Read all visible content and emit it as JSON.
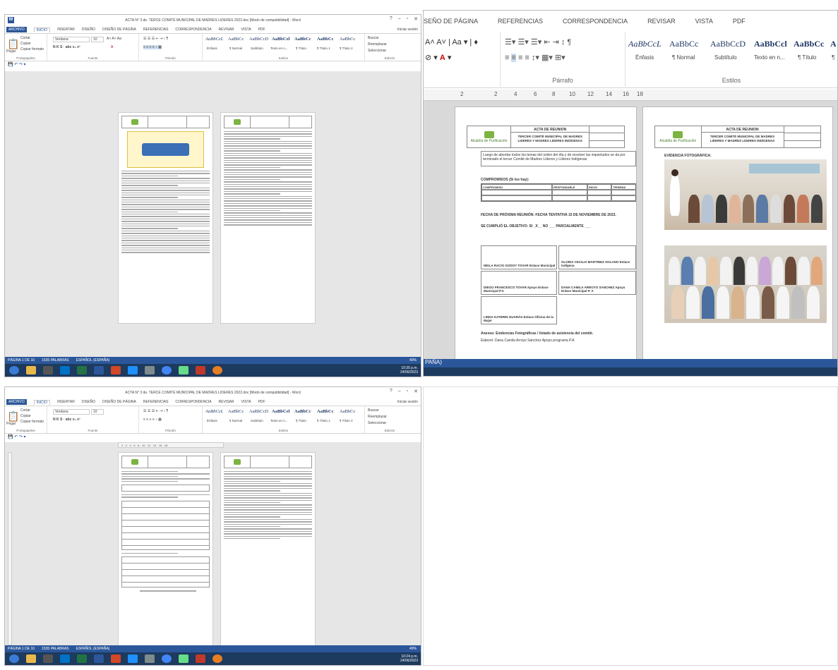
{
  "top_left": {
    "window_title": "ACTA N° 3 de. TERCE COMITÉ MUNICIPAL DE MADRES LIDERES 2022.doc [Modo de compatibilidad] - Word",
    "menu": [
      "ARCHIVO",
      "INICIO",
      "INSERTAR",
      "DISEÑO",
      "DISEÑO DE PÁGINA",
      "REFERENCIAS",
      "CORRESPONDENCIA",
      "REVISAR",
      "VISTA",
      "PDF"
    ],
    "login": "Iniciar sesión",
    "clipboard": {
      "paste": "Pegar",
      "cut": "Cortar",
      "copy": "Copiar",
      "format": "Copiar formato",
      "label": "Portapapeles"
    },
    "font": {
      "name": "Verdana",
      "size": "10",
      "label": "Fuente"
    },
    "paragraph_label": "Párrafo",
    "styles": [
      {
        "preview": "AaBbCcL",
        "name": "Énfasis"
      },
      {
        "preview": "AaBbCc",
        "name": "¶ Normal"
      },
      {
        "preview": "AaBbCcD",
        "name": "Subtítulo"
      },
      {
        "preview": "AaBbCel",
        "name": "Texto en n..."
      },
      {
        "preview": "AaBbCc",
        "name": "¶ Título"
      },
      {
        "preview": "AaBbCc",
        "name": "¶ Título 1"
      },
      {
        "preview": "AaBbCc",
        "name": "¶ Título 2"
      }
    ],
    "styles_label": "Estilos",
    "edit": {
      "find": "Buscar",
      "replace": "Reemplazar",
      "select": "Seleccionar",
      "label": "Edición"
    },
    "status": {
      "page": "PÁGINA 1 DE 10",
      "words": "1535 PALABRAS",
      "lang": "ESPAÑOL (ESPAÑA)",
      "zoom": "40%"
    },
    "clock": {
      "time": "10:35 p.m.",
      "date": "24/06/2023"
    }
  },
  "top_right": {
    "tabs": [
      "SEÑO DE PÁGINA",
      "REFERENCIAS",
      "CORRESPONDENCIA",
      "REVISAR",
      "VISTA",
      "PDF"
    ],
    "styles": [
      {
        "preview": "AaBbCcL",
        "name": "Énfasis"
      },
      {
        "preview": "AaBbCc",
        "name": "¶ Normal"
      },
      {
        "preview": "AaBbCcD",
        "name": "Subtítulo"
      },
      {
        "preview": "AaBbCcl",
        "name": "Texto en n..."
      },
      {
        "preview": "AaBbCc",
        "name": "¶ Título"
      },
      {
        "preview": "A",
        "name": "¶"
      }
    ],
    "paragraph_label": "Párrafo",
    "styles_label": "Estilos",
    "ruler": [
      "2",
      "2",
      "4",
      "6",
      "8",
      "10",
      "12",
      "14",
      "16",
      "18"
    ],
    "acta": {
      "header_title": "ACTA DE REUNION",
      "header_sub": "TERCER COMITÉ MUNICIPAL DE MADRES LIDERES Y MADRES LIDERES INDÍGENAS",
      "logo": "Alcaldía de Purificación",
      "intro": "Luego de abordar todos los temas del orden del día y de resolver las inquietudes se da por terminado el tercer Comité de Madres Líderes y Líderes Indígenas",
      "compromisos_title": "COMPROMISOS (Si los hay):",
      "compromisos_cols": [
        "COMPROMISO",
        "RESPONSABLE",
        "INICIO",
        "TERMINA"
      ],
      "next_meeting": "FECHA DE PRÓXIMA REUNIÓN: FECHA TENTATIVA 15 DE NOVIEMBRE DE 2023.",
      "objective": "SE CUMPLIÓ EL OBJETIVO: SI _X__ NO ___ PARCIALMENTE ___",
      "signatures": [
        "NEILA RACIO GODOY TOVAR Enlace Municipal",
        "GLORIA CECILIA MARTÍNEZ SOLANO Enlace Indígena",
        "DIEGO FRANCESCO TOVAR Apoyo Enlace Municipal P.A",
        "DANA CAMILA ARROYO SANCHEZ Apoyo Enlace Municipal P. A",
        "LINDA KATERIN GUARÁS Enlace Oficina de la Mujer"
      ],
      "annexes": "Anexos: Evidencias Fotográficas / listado de asistencia del comité.",
      "elaboro": "Elaboró: Dana Camila Arroyo Sánchez Apoyo programa P.A",
      "evidence_title": "EVIDENCIA FOTOGRÁFICA:"
    },
    "status_fragment": "PAÑA)"
  },
  "bottom_left": {
    "window_title": "ACTA N° 3 de. TERCE COMITÉ MUNICIPAL DE MADRES LIDERES 2022.doc [Modo de compatibilidad] - Word",
    "login": "Iniciar sesión",
    "status": {
      "page": "PÁGINA 1 DE 10",
      "words": "1535 PALABRAS",
      "lang": "ESPAÑOL (ESPAÑA)",
      "zoom": "40%"
    },
    "clock": {
      "time": "10:24 p.m.",
      "date": "24/06/2023"
    }
  },
  "colors": {
    "word_blue": "#2b579a",
    "taskbar": "#1d3a5f",
    "doc_bg": "#d9d9d9",
    "logo_green": "#7cb342"
  }
}
